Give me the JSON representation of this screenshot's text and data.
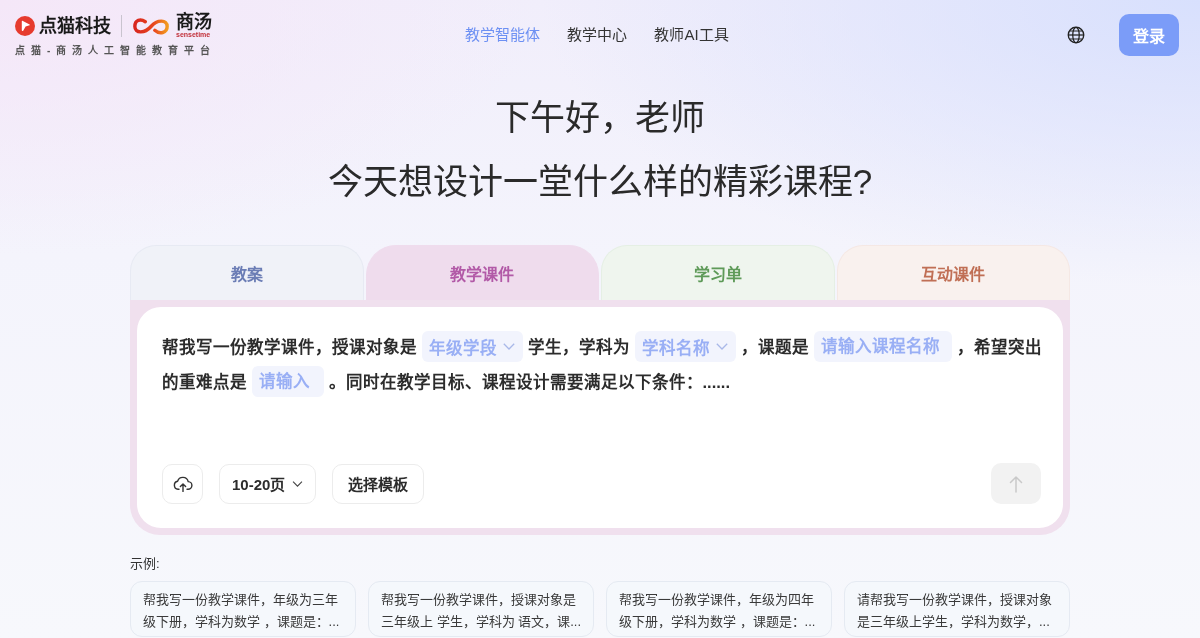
{
  "header": {
    "logo": {
      "brand": "点猫科技",
      "partner": "商汤",
      "partner_latin": "sensetime",
      "tagline": "点猫-商汤人工智能教育平台"
    },
    "nav": [
      {
        "label": "教学智能体",
        "selected": true
      },
      {
        "label": "教学中心",
        "selected": false
      },
      {
        "label": "教师AI工具",
        "selected": false
      }
    ],
    "login_button": "登录"
  },
  "greeting": [
    "下午好，老师",
    "今天想设计一堂什么样的精彩课程?"
  ],
  "tabs": [
    {
      "label": "教案",
      "selected": false,
      "color": "#6b7db5"
    },
    {
      "label": "教学课件",
      "selected": true,
      "color": "#b25aa7"
    },
    {
      "label": "学习单",
      "selected": false,
      "color": "#5e9a58"
    },
    {
      "label": "互动课件",
      "selected": false,
      "color": "#c06f55"
    }
  ],
  "prompt": {
    "lines": [
      [
        {
          "kind": "text",
          "text": "帮我写一份教学课件，授课对象是"
        },
        {
          "kind": "select",
          "placeholder": "年级学段"
        },
        {
          "kind": "text",
          "text": "学生，学科为"
        },
        {
          "kind": "select",
          "placeholder": "学科名称"
        },
        {
          "kind": "text",
          "text": "，课题是"
        },
        {
          "kind": "input",
          "placeholder": "请输入课程名称"
        },
        {
          "kind": "text",
          "text": "，希望突出"
        }
      ],
      [
        {
          "kind": "text",
          "text": "的重难点是"
        },
        {
          "kind": "input",
          "placeholder": "请输入"
        },
        {
          "kind": "text",
          "text": "。同时在教学目标、课程设计需要满足以下条件：......"
        }
      ]
    ],
    "page_range": "10-20页",
    "template_button": "选择模板",
    "send": {
      "disabled": true
    }
  },
  "examples": {
    "label": "示例:",
    "items": [
      "帮我写一份教学课件，年级为三年级下册，学科为数学 ，课题是：...",
      "帮我写一份教学课件，授课对象是三年级上 学生，学科为 语文，课...",
      "帮我写一份教学课件，年级为四年级下册，学科为数学 ，课题是：...",
      "请帮我写一份教学课件，授课对象是三年级上学生，学科为数学，..."
    ]
  }
}
